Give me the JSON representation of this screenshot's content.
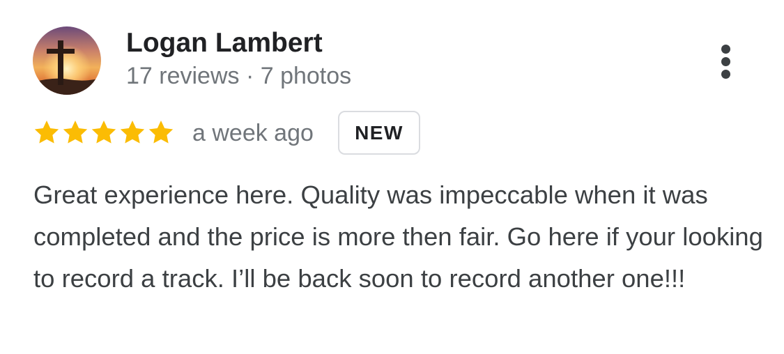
{
  "review": {
    "author_name": "Logan Lambert",
    "author_meta": "17 reviews · 7 photos",
    "avatar_icon": "cross-sunset-avatar",
    "rating": 5,
    "rating_max": 5,
    "star_color": "#fbbc04",
    "time_ago": "a week ago",
    "badge": "NEW",
    "text": "Great experience here. Quality was impeccable when it was completed and the price is more then fair. Go here if your looking to record a track. I’ll be back soon to record another one!!!"
  },
  "actions": {
    "more_icon": "more-vert-icon"
  }
}
